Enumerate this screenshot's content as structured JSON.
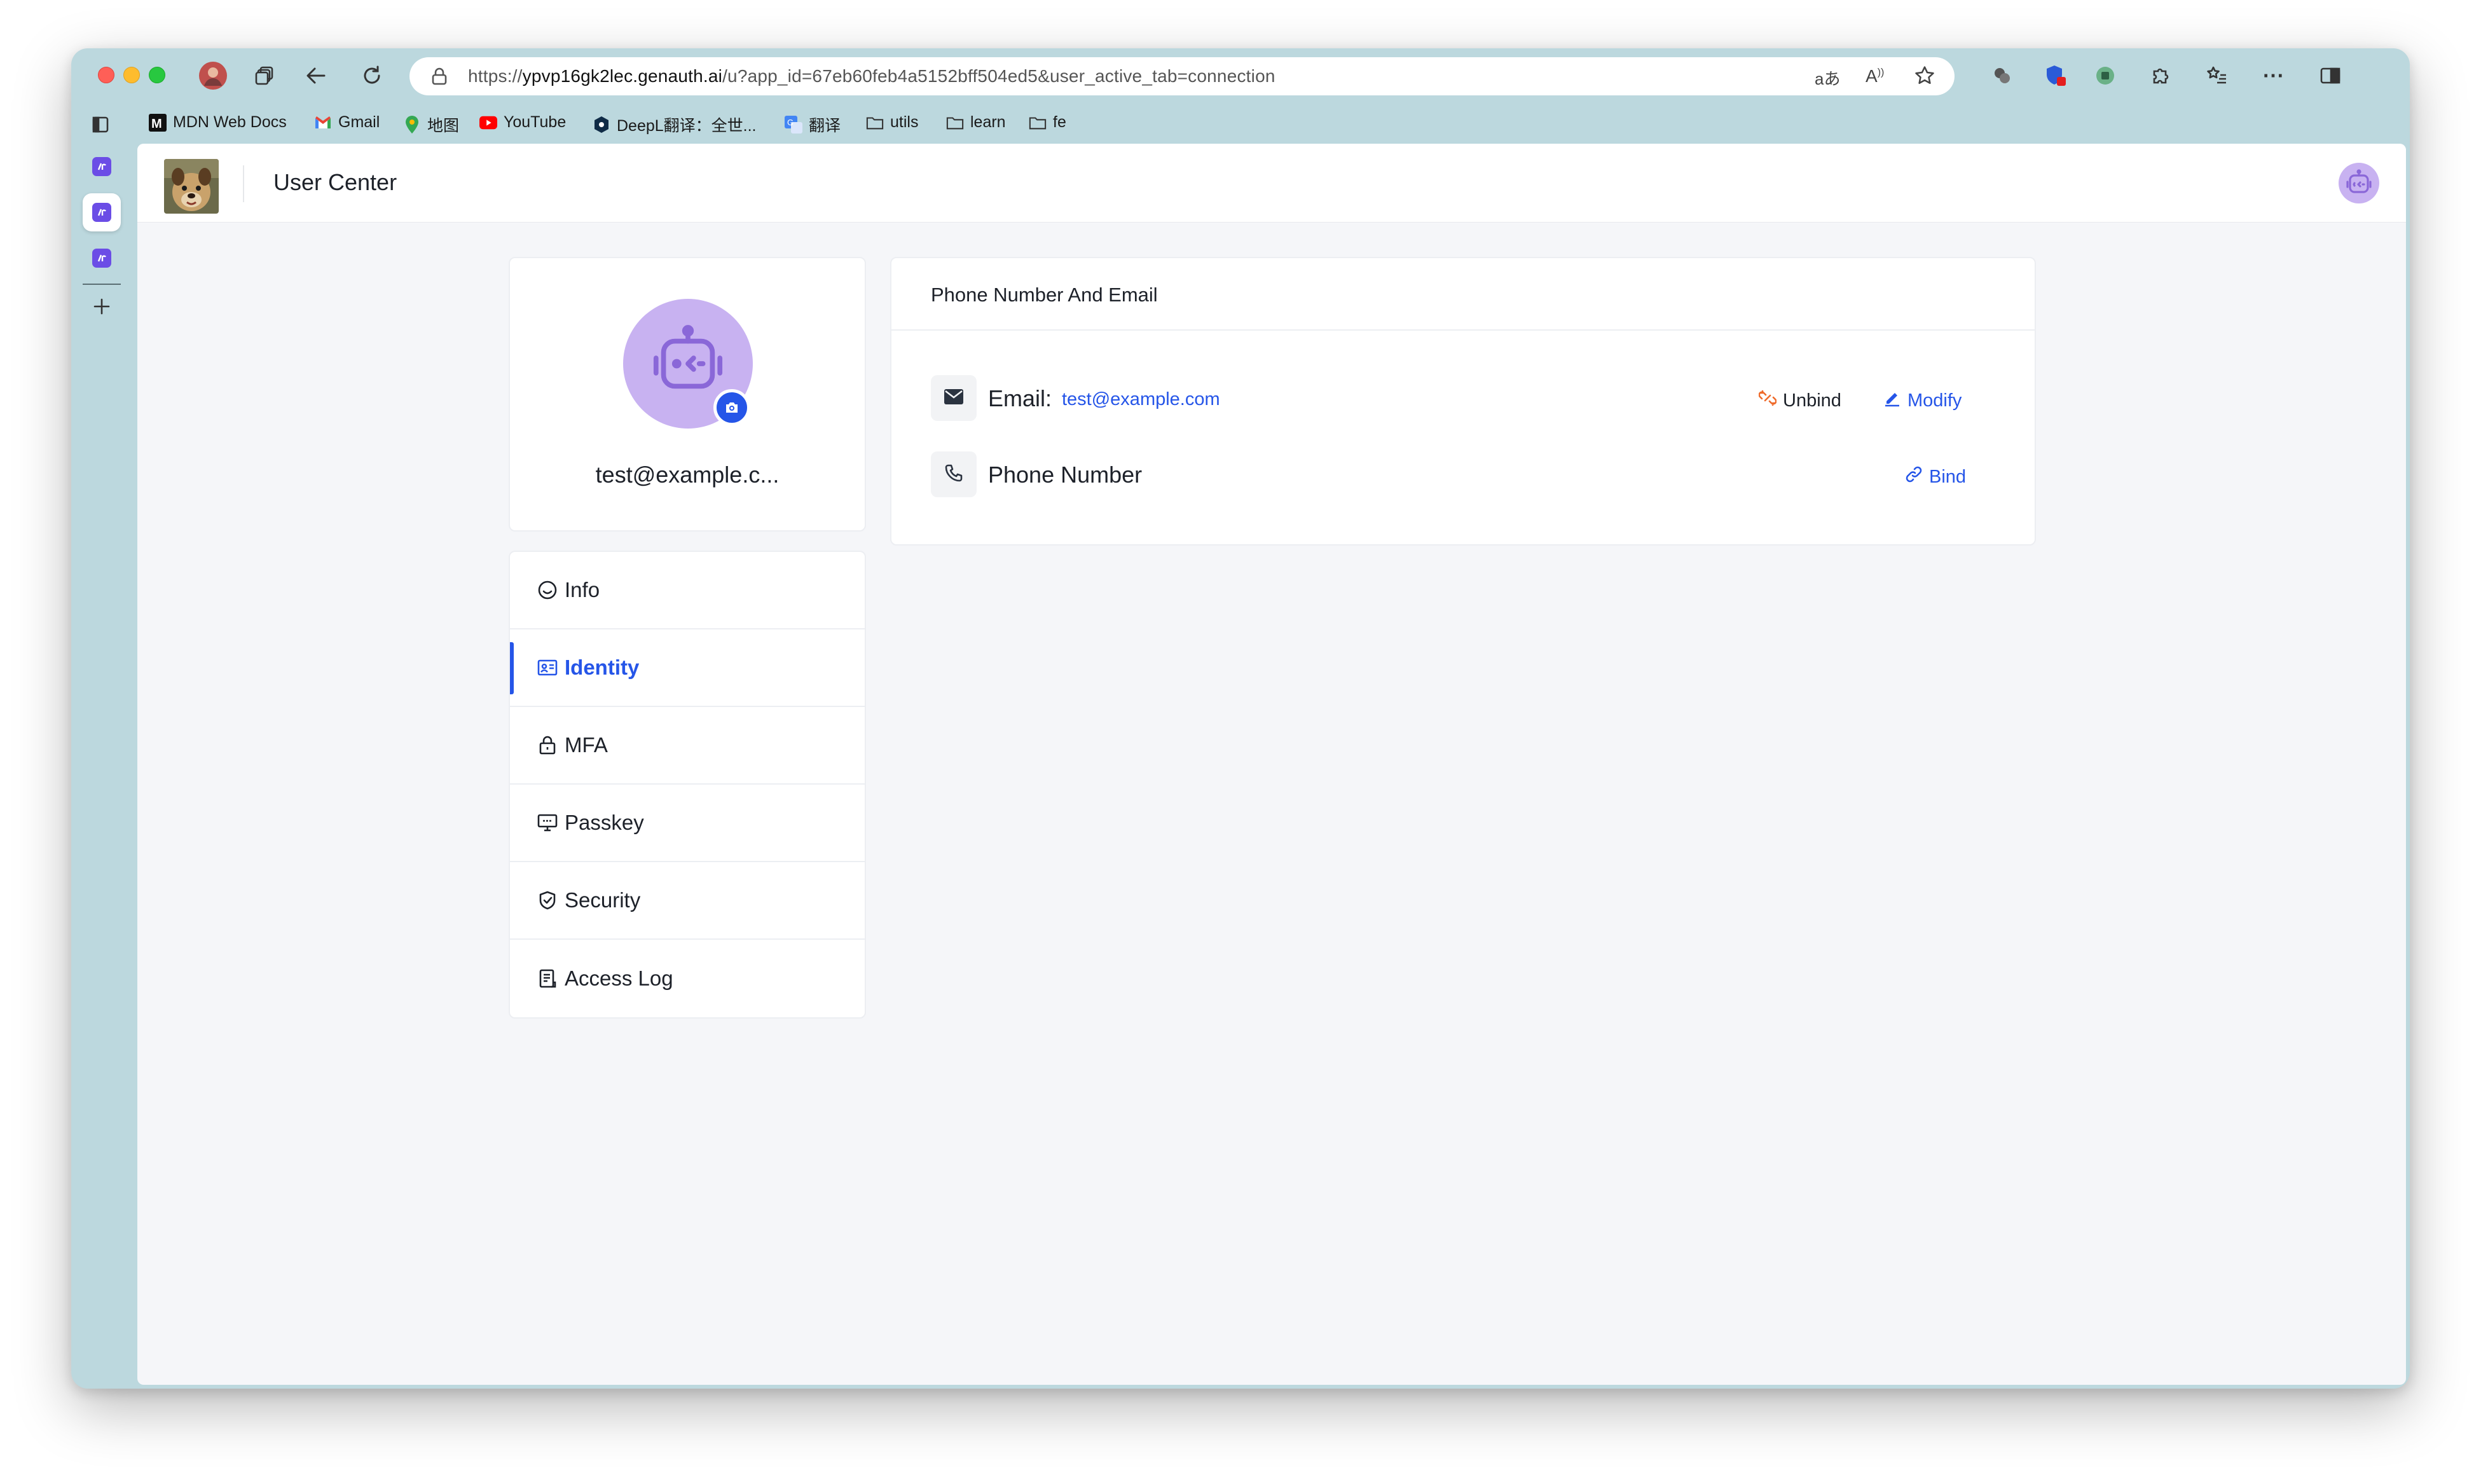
{
  "browser": {
    "url_scheme": "https://",
    "url_host": "ypvp16gk2lec.genauth.ai",
    "url_path": "/u?app_id=67eb60feb4a5152bff504ed5&user_active_tab=connection",
    "bookmarks": [
      {
        "label": "MDN Web Docs",
        "icon": "mdn-icon"
      },
      {
        "label": "Gmail",
        "icon": "gmail-icon"
      },
      {
        "label": "地图",
        "icon": "maps-icon"
      },
      {
        "label": "YouTube",
        "icon": "youtube-icon"
      },
      {
        "label": "DeepL翻译：全世...",
        "icon": "deepl-icon"
      },
      {
        "label": "翻译",
        "icon": "translate-icon"
      },
      {
        "label": "utils",
        "icon": "folder-icon"
      },
      {
        "label": "learn",
        "icon": "folder-icon"
      },
      {
        "label": "fe",
        "icon": "folder-icon"
      }
    ],
    "read_aloud_text": "aあ",
    "colors": {
      "frame": "#bcd8de",
      "tab_icon": "#6b4de6"
    }
  },
  "header": {
    "title": "User Center"
  },
  "profile": {
    "name": "test@example.c..."
  },
  "menu": {
    "items": [
      {
        "label": "Info",
        "icon": "smile-icon"
      },
      {
        "label": "Identity",
        "icon": "id-card-icon",
        "active": true
      },
      {
        "label": "MFA",
        "icon": "lock-icon"
      },
      {
        "label": "Passkey",
        "icon": "monitor-key-icon"
      },
      {
        "label": "Security",
        "icon": "shield-check-icon"
      },
      {
        "label": "Access Log",
        "icon": "log-list-icon"
      }
    ]
  },
  "contact": {
    "title": "Phone Number And Email",
    "email_label": "Email:",
    "email_value": "test@example.com",
    "unbind_label": "Unbind",
    "modify_label": "Modify",
    "phone_label": "Phone Number",
    "bind_label": "Bind"
  },
  "colors": {
    "primary": "#2555e8",
    "avatar_bg": "#c8b2f1",
    "page_bg": "#f5f6f9",
    "unbind_icon": "#ef6b2b"
  }
}
